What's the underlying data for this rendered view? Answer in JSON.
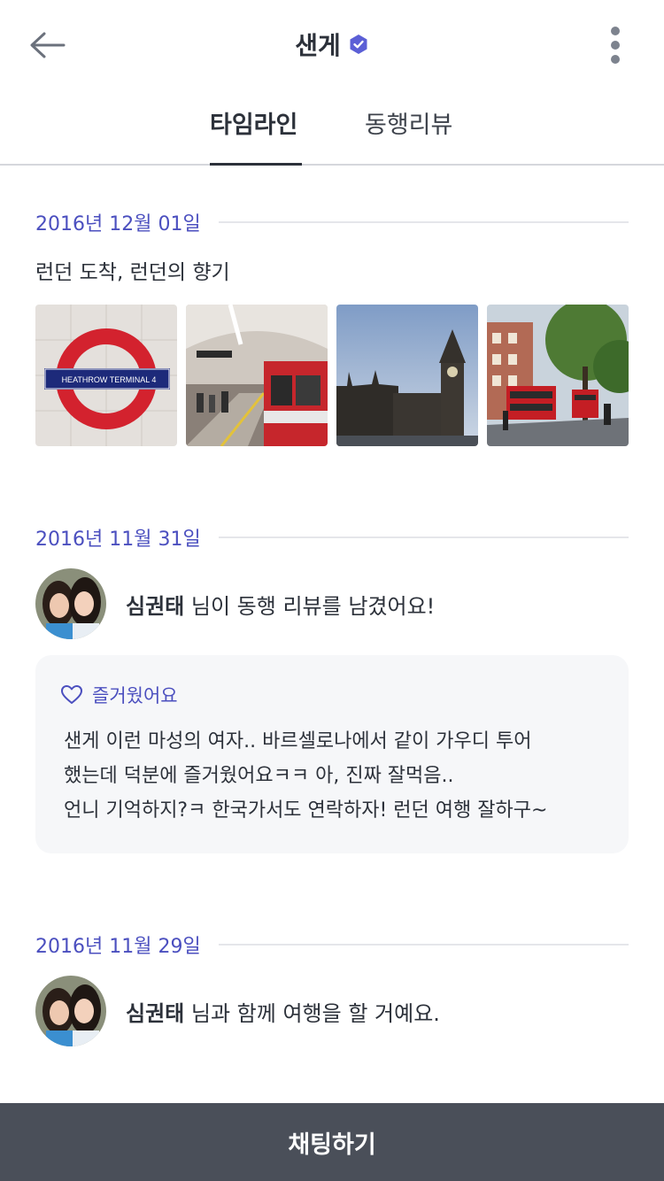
{
  "header": {
    "title": "샌게",
    "back_icon": "arrow-left-icon",
    "verified_icon": "verified-badge-icon",
    "more_icon": "more-vertical-icon"
  },
  "tabs": [
    {
      "label": "타임라인",
      "active": true
    },
    {
      "label": "동행리뷰",
      "active": false
    }
  ],
  "timeline": [
    {
      "date": "2016년 12월 01일",
      "text": "런던 도착, 런던의 향기",
      "photos": [
        "heathrow-terminal-4-sign",
        "underground-train",
        "big-ben",
        "london-street-buses"
      ],
      "photo_sign_text": "HEATHROW  TERMINAL 4"
    },
    {
      "date": "2016년 11월 31일",
      "user": "심권태",
      "action": " 님이 동행 리뷰를 남겼어요!",
      "review": {
        "tag_icon": "heart-outline-icon",
        "tag": "즐거웠어요",
        "lines": [
          "샌게 이런 마성의 여자.. 바르셀로나에서 같이 가우디 투어",
          "했는데 덕분에 즐거웠어요ㅋㅋ 아, 진짜 잘먹음..",
          "언니 기억하지?ㅋ 한국가서도 연락하자! 런던 여행 잘하구~"
        ]
      }
    },
    {
      "date": "2016년 11월 29일",
      "user": "심권태",
      "action": " 님과 함께 여행을 할 거예요."
    }
  ],
  "chat_button": {
    "label": "채팅하기"
  },
  "colors": {
    "accent": "#4b4fbf",
    "verified": "#5b5fd6",
    "chat_bar": "#4a4f59"
  }
}
